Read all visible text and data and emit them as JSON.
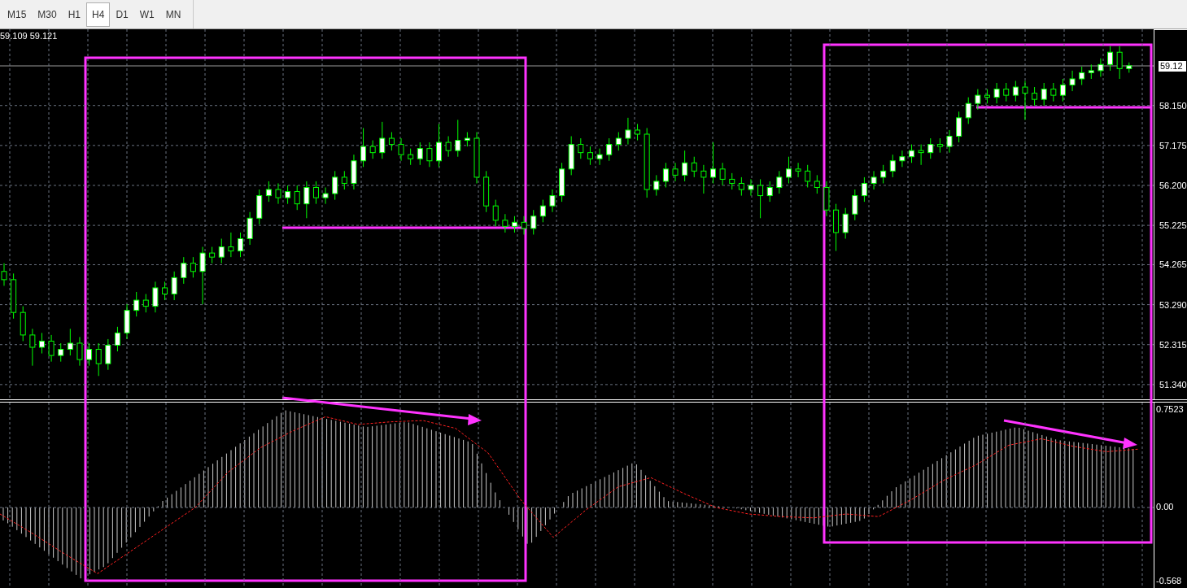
{
  "timeframe_tabs": [
    {
      "label": "M15",
      "selected": false
    },
    {
      "label": "M30",
      "selected": false
    },
    {
      "label": "H1",
      "selected": false
    },
    {
      "label": "H4",
      "selected": true
    },
    {
      "label": "D1",
      "selected": false
    },
    {
      "label": "W1",
      "selected": false
    },
    {
      "label": "MN",
      "selected": false
    }
  ],
  "price_chart": {
    "bid_ask": "59.109 59.121",
    "current_price": "59.12",
    "chart_data": {
      "type": "candlestick",
      "ylim": [
        50.98,
        60.01
      ],
      "grid": true,
      "yticks": [
        {
          "value": 58.15,
          "label": "58.150"
        },
        {
          "value": 57.175,
          "label": "57.175"
        },
        {
          "value": 56.2,
          "label": "56.200"
        },
        {
          "value": 55.225,
          "label": "55.225"
        },
        {
          "value": 54.265,
          "label": "54.265"
        },
        {
          "value": 53.29,
          "label": "53.290"
        },
        {
          "value": 52.315,
          "label": "52.315"
        },
        {
          "value": 51.34,
          "label": "51.340"
        }
      ],
      "ohlc": [
        [
          54.1,
          54.3,
          53.75,
          53.9
        ],
        [
          53.9,
          54.05,
          52.95,
          53.1
        ],
        [
          53.1,
          53.25,
          52.4,
          52.55
        ],
        [
          52.55,
          52.7,
          51.8,
          52.25
        ],
        [
          52.25,
          52.6,
          52.1,
          52.4
        ],
        [
          52.4,
          52.55,
          51.9,
          52.05
        ],
        [
          52.05,
          52.35,
          51.9,
          52.2
        ],
        [
          52.2,
          52.7,
          52.05,
          52.35
        ],
        [
          52.35,
          52.5,
          51.8,
          51.95
        ],
        [
          51.95,
          52.35,
          51.8,
          52.2
        ],
        [
          52.2,
          52.35,
          51.55,
          51.85
        ],
        [
          51.85,
          52.45,
          51.7,
          52.3
        ],
        [
          52.3,
          52.75,
          52.15,
          52.6
        ],
        [
          52.6,
          53.3,
          52.45,
          53.15
        ],
        [
          53.15,
          53.6,
          53.0,
          53.4
        ],
        [
          53.4,
          53.55,
          53.1,
          53.25
        ],
        [
          53.25,
          53.85,
          53.1,
          53.7
        ],
        [
          53.7,
          53.85,
          53.4,
          53.55
        ],
        [
          53.55,
          54.1,
          53.4,
          53.95
        ],
        [
          53.95,
          54.45,
          53.8,
          54.3
        ],
        [
          54.3,
          54.45,
          53.95,
          54.1
        ],
        [
          54.1,
          54.7,
          53.3,
          54.55
        ],
        [
          54.55,
          54.7,
          54.3,
          54.45
        ],
        [
          54.45,
          54.9,
          54.3,
          54.7
        ],
        [
          54.7,
          55.05,
          54.45,
          54.6
        ],
        [
          54.6,
          55.05,
          54.45,
          54.9
        ],
        [
          54.9,
          55.55,
          54.75,
          55.4
        ],
        [
          55.4,
          56.1,
          55.25,
          55.95
        ],
        [
          55.95,
          56.3,
          55.8,
          56.1
        ],
        [
          56.1,
          56.25,
          55.75,
          55.9
        ],
        [
          55.9,
          56.2,
          55.75,
          56.05
        ],
        [
          56.05,
          56.2,
          55.6,
          55.75
        ],
        [
          55.75,
          56.3,
          55.4,
          56.15
        ],
        [
          56.15,
          56.3,
          55.75,
          55.9
        ],
        [
          55.9,
          56.15,
          55.75,
          56.0
        ],
        [
          56.0,
          56.55,
          55.85,
          56.4
        ],
        [
          56.4,
          56.55,
          56.1,
          56.25
        ],
        [
          56.25,
          56.95,
          56.1,
          56.8
        ],
        [
          56.8,
          57.6,
          56.65,
          57.15
        ],
        [
          57.15,
          57.3,
          56.85,
          57.0
        ],
        [
          57.0,
          57.75,
          56.85,
          57.35
        ],
        [
          57.35,
          57.5,
          57.05,
          57.2
        ],
        [
          57.2,
          57.35,
          56.8,
          56.95
        ],
        [
          56.95,
          57.1,
          56.7,
          56.85
        ],
        [
          56.85,
          57.25,
          56.7,
          57.1
        ],
        [
          57.1,
          57.25,
          56.65,
          56.8
        ],
        [
          56.8,
          57.7,
          56.65,
          57.25
        ],
        [
          57.25,
          57.4,
          56.9,
          57.05
        ],
        [
          57.05,
          57.8,
          56.9,
          57.3
        ],
        [
          57.3,
          57.5,
          57.15,
          57.35
        ],
        [
          57.35,
          57.5,
          56.25,
          56.4
        ],
        [
          56.4,
          56.55,
          55.55,
          55.7
        ],
        [
          55.7,
          55.85,
          55.2,
          55.35
        ],
        [
          55.35,
          55.5,
          55.05,
          55.2
        ],
        [
          55.2,
          55.45,
          55.05,
          55.3
        ],
        [
          55.3,
          55.45,
          55.0,
          55.15
        ],
        [
          55.15,
          55.6,
          55.0,
          55.45
        ],
        [
          55.45,
          55.85,
          55.3,
          55.7
        ],
        [
          55.7,
          56.1,
          55.55,
          55.95
        ],
        [
          55.95,
          56.75,
          55.8,
          56.6
        ],
        [
          56.6,
          57.4,
          56.45,
          57.2
        ],
        [
          57.2,
          57.35,
          56.85,
          57.0
        ],
        [
          57.0,
          57.15,
          56.7,
          56.85
        ],
        [
          56.85,
          57.1,
          56.7,
          56.95
        ],
        [
          56.95,
          57.35,
          56.8,
          57.2
        ],
        [
          57.2,
          57.5,
          57.05,
          57.35
        ],
        [
          57.35,
          57.85,
          57.2,
          57.55
        ],
        [
          57.55,
          57.7,
          57.3,
          57.45
        ],
        [
          57.45,
          57.6,
          55.9,
          56.1
        ],
        [
          56.1,
          56.45,
          55.95,
          56.3
        ],
        [
          56.3,
          56.75,
          56.15,
          56.6
        ],
        [
          56.6,
          56.75,
          56.3,
          56.45
        ],
        [
          56.45,
          57.05,
          56.3,
          56.75
        ],
        [
          56.75,
          56.9,
          56.4,
          56.55
        ],
        [
          56.55,
          56.7,
          56.0,
          56.4
        ],
        [
          56.4,
          57.25,
          56.25,
          56.6
        ],
        [
          56.6,
          56.75,
          56.2,
          56.35
        ],
        [
          56.35,
          56.5,
          56.1,
          56.25
        ],
        [
          56.25,
          56.4,
          55.95,
          56.1
        ],
        [
          56.1,
          56.35,
          55.95,
          56.2
        ],
        [
          56.2,
          56.35,
          55.4,
          55.95
        ],
        [
          55.95,
          56.3,
          55.8,
          56.15
        ],
        [
          56.15,
          56.55,
          56.0,
          56.4
        ],
        [
          56.4,
          56.9,
          56.25,
          56.6
        ],
        [
          56.6,
          56.75,
          56.4,
          56.55
        ],
        [
          56.55,
          56.7,
          56.15,
          56.3
        ],
        [
          56.3,
          56.45,
          56.0,
          56.15
        ],
        [
          56.15,
          56.3,
          55.45,
          55.6
        ],
        [
          55.6,
          55.75,
          54.6,
          55.05
        ],
        [
          55.05,
          55.65,
          54.9,
          55.5
        ],
        [
          55.5,
          56.1,
          55.35,
          55.95
        ],
        [
          55.95,
          56.4,
          55.8,
          56.25
        ],
        [
          56.25,
          56.55,
          56.1,
          56.4
        ],
        [
          56.4,
          56.7,
          56.25,
          56.55
        ],
        [
          56.55,
          56.95,
          56.4,
          56.8
        ],
        [
          56.8,
          57.05,
          56.65,
          56.9
        ],
        [
          56.9,
          57.2,
          56.75,
          57.05
        ],
        [
          57.05,
          57.2,
          56.7,
          57.0
        ],
        [
          57.0,
          57.35,
          56.85,
          57.2
        ],
        [
          57.2,
          57.35,
          57.0,
          57.15
        ],
        [
          57.15,
          57.55,
          57.0,
          57.4
        ],
        [
          57.4,
          58.0,
          57.25,
          57.85
        ],
        [
          57.85,
          58.35,
          57.7,
          58.2
        ],
        [
          58.2,
          58.55,
          58.05,
          58.4
        ],
        [
          58.4,
          58.55,
          58.2,
          58.35
        ],
        [
          58.35,
          58.7,
          58.2,
          58.55
        ],
        [
          58.55,
          58.7,
          58.25,
          58.4
        ],
        [
          58.4,
          58.75,
          58.25,
          58.6
        ],
        [
          58.6,
          58.75,
          57.8,
          58.45
        ],
        [
          58.45,
          58.6,
          58.15,
          58.3
        ],
        [
          58.3,
          58.7,
          58.15,
          58.55
        ],
        [
          58.55,
          58.7,
          58.25,
          58.4
        ],
        [
          58.4,
          58.8,
          58.25,
          58.65
        ],
        [
          58.65,
          59.0,
          58.5,
          58.8
        ],
        [
          58.8,
          59.1,
          58.65,
          58.95
        ],
        [
          58.95,
          59.15,
          58.8,
          59.0
        ],
        [
          59.0,
          59.3,
          58.85,
          59.15
        ],
        [
          59.15,
          59.6,
          59.0,
          59.45
        ],
        [
          59.45,
          59.6,
          58.8,
          59.05
        ],
        [
          59.05,
          59.2,
          58.95,
          59.12
        ]
      ]
    }
  },
  "indicator": {
    "chart_data": {
      "type": "line",
      "ylim": [
        -0.6207,
        0.8088
      ],
      "grid": true,
      "yticks": [
        {
          "value": 0.7523,
          "label": "0.7523"
        },
        {
          "value": 0,
          "label": "0.00"
        },
        {
          "value": -0.568,
          "label": "-0.568"
        }
      ],
      "series": [
        {
          "color": "#ff2020",
          "line_style": "dashed",
          "values": [
            -0.05,
            -0.2,
            -0.36,
            -0.51,
            -0.34,
            -0.17,
            0.0,
            0.27,
            0.46,
            0.59,
            0.7,
            0.64,
            0.66,
            0.67,
            0.61,
            0.42,
            0.06,
            -0.23,
            -0.02,
            0.16,
            0.23,
            0.11,
            0.0,
            -0.05,
            -0.07,
            -0.08,
            -0.05,
            -0.07,
            0.06,
            0.21,
            0.33,
            0.48,
            0.53,
            0.47,
            0.43,
            0.45
          ]
        }
      ]
    }
  }
}
